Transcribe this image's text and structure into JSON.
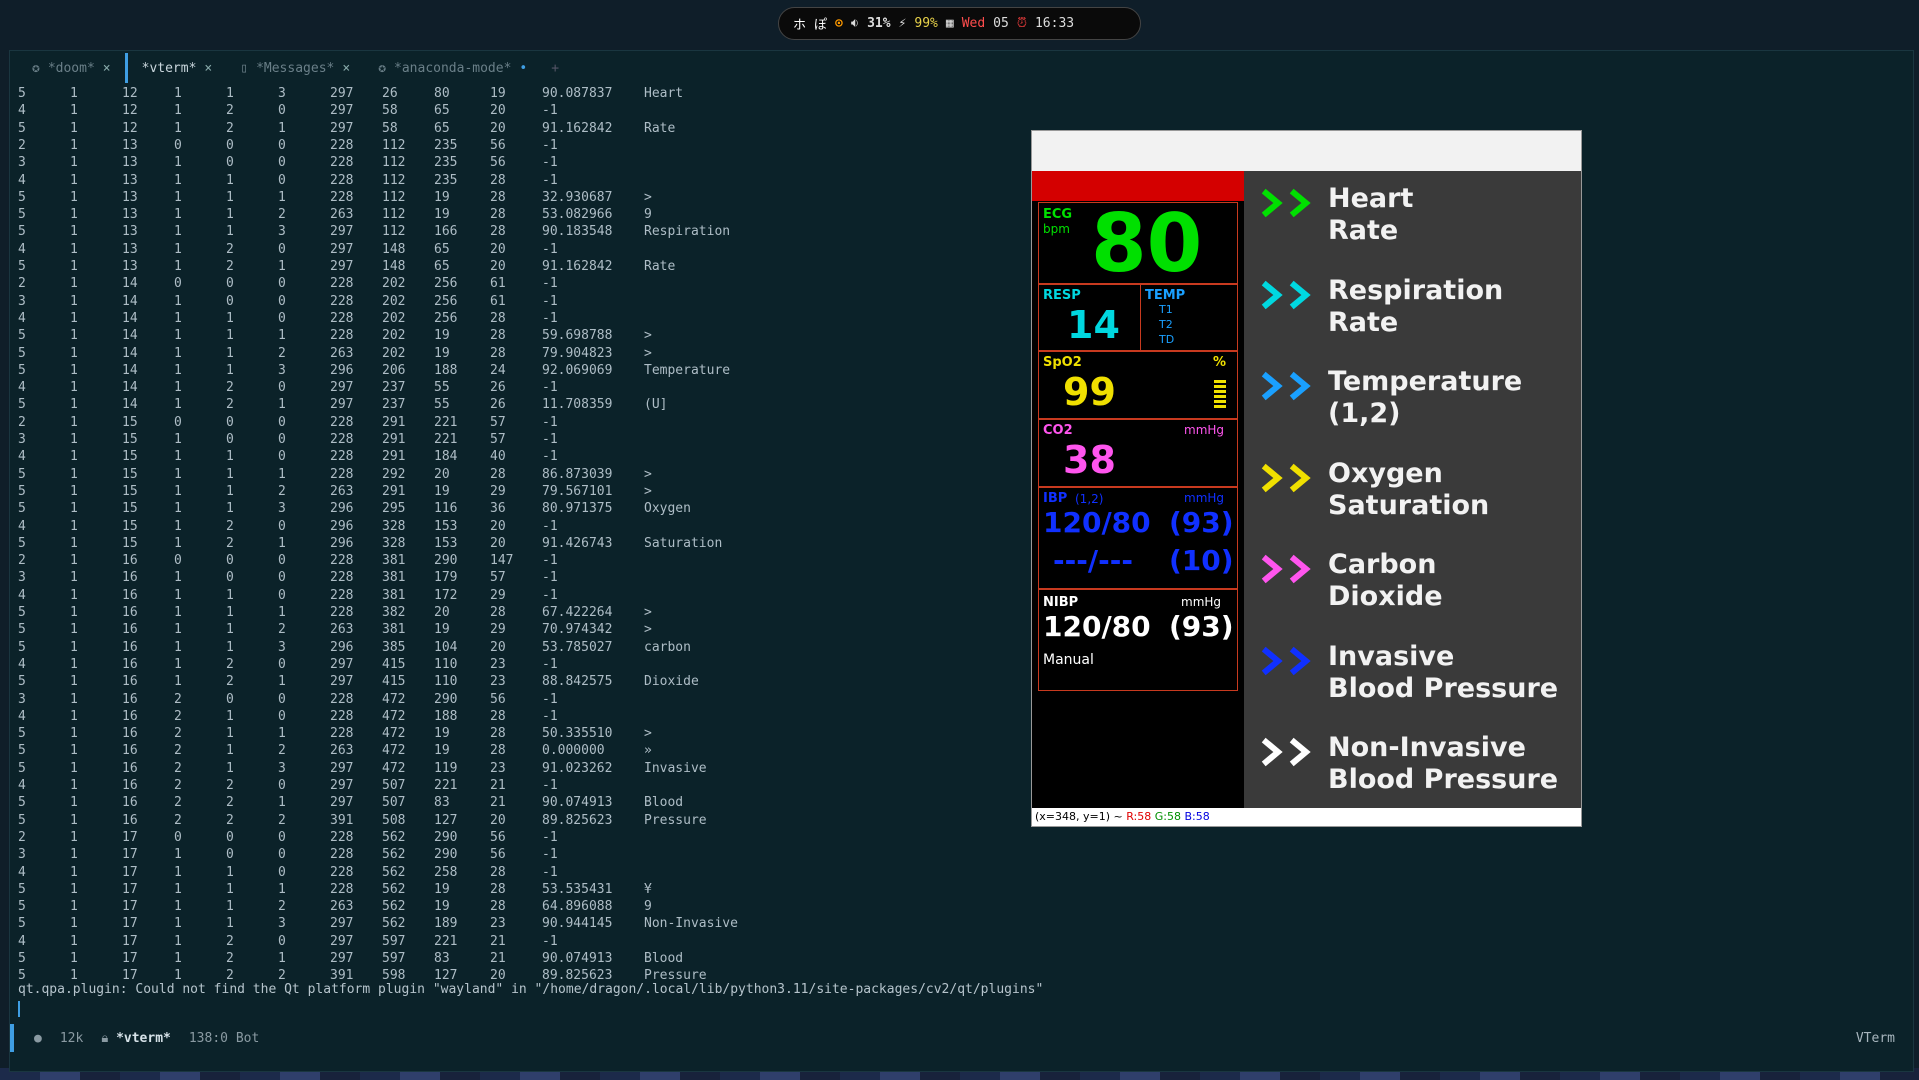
{
  "topbar": {
    "ime1": "ホ",
    "ime2": "ぽ",
    "volume": "31%",
    "battery": "99%",
    "day": "Wed",
    "date": "05",
    "time": "16:33",
    "icons": [
      "rss-icon",
      "speaker-icon",
      "plug-icon",
      "calendar-icon",
      "alarm-icon"
    ]
  },
  "tabs": [
    {
      "label": "*doom*",
      "close": "×"
    },
    {
      "label": "*vterm*",
      "close": "×"
    },
    {
      "label": "*Messages*",
      "close": "×"
    },
    {
      "label": "*anaconda-mode*",
      "close": "•"
    }
  ],
  "tab_add": "+",
  "terminal": {
    "rows": [
      [
        "5",
        "1",
        "12",
        "1",
        "1",
        "3",
        "297",
        "26",
        "80",
        "19",
        "90.087837",
        "Heart"
      ],
      [
        "4",
        "1",
        "12",
        "1",
        "2",
        "0",
        "297",
        "58",
        "65",
        "20",
        "-1",
        ""
      ],
      [
        "5",
        "1",
        "12",
        "1",
        "2",
        "1",
        "297",
        "58",
        "65",
        "20",
        "91.162842",
        "Rate"
      ],
      [
        "2",
        "1",
        "13",
        "0",
        "0",
        "0",
        "228",
        "112",
        "235",
        "56",
        "-1",
        ""
      ],
      [
        "3",
        "1",
        "13",
        "1",
        "0",
        "0",
        "228",
        "112",
        "235",
        "56",
        "-1",
        ""
      ],
      [
        "4",
        "1",
        "13",
        "1",
        "1",
        "0",
        "228",
        "112",
        "235",
        "28",
        "-1",
        ""
      ],
      [
        "5",
        "1",
        "13",
        "1",
        "1",
        "1",
        "228",
        "112",
        "19",
        "28",
        "32.930687",
        ">"
      ],
      [
        "5",
        "1",
        "13",
        "1",
        "1",
        "2",
        "263",
        "112",
        "19",
        "28",
        "53.082966",
        "9"
      ],
      [
        "5",
        "1",
        "13",
        "1",
        "1",
        "3",
        "297",
        "112",
        "166",
        "28",
        "90.183548",
        "Respiration"
      ],
      [
        "4",
        "1",
        "13",
        "1",
        "2",
        "0",
        "297",
        "148",
        "65",
        "20",
        "-1",
        ""
      ],
      [
        "5",
        "1",
        "13",
        "1",
        "2",
        "1",
        "297",
        "148",
        "65",
        "20",
        "91.162842",
        "Rate"
      ],
      [
        "2",
        "1",
        "14",
        "0",
        "0",
        "0",
        "228",
        "202",
        "256",
        "61",
        "-1",
        ""
      ],
      [
        "3",
        "1",
        "14",
        "1",
        "0",
        "0",
        "228",
        "202",
        "256",
        "61",
        "-1",
        ""
      ],
      [
        "4",
        "1",
        "14",
        "1",
        "1",
        "0",
        "228",
        "202",
        "256",
        "28",
        "-1",
        ""
      ],
      [
        "5",
        "1",
        "14",
        "1",
        "1",
        "1",
        "228",
        "202",
        "19",
        "28",
        "59.698788",
        ">"
      ],
      [
        "5",
        "1",
        "14",
        "1",
        "1",
        "2",
        "263",
        "202",
        "19",
        "28",
        "79.904823",
        ">"
      ],
      [
        "5",
        "1",
        "14",
        "1",
        "1",
        "3",
        "296",
        "206",
        "188",
        "24",
        "92.069069",
        "Temperature"
      ],
      [
        "4",
        "1",
        "14",
        "1",
        "2",
        "0",
        "297",
        "237",
        "55",
        "26",
        "-1",
        ""
      ],
      [
        "5",
        "1",
        "14",
        "1",
        "2",
        "1",
        "297",
        "237",
        "55",
        "26",
        "11.708359",
        "(U]"
      ],
      [
        "2",
        "1",
        "15",
        "0",
        "0",
        "0",
        "228",
        "291",
        "221",
        "57",
        "-1",
        ""
      ],
      [
        "3",
        "1",
        "15",
        "1",
        "0",
        "0",
        "228",
        "291",
        "221",
        "57",
        "-1",
        ""
      ],
      [
        "4",
        "1",
        "15",
        "1",
        "1",
        "0",
        "228",
        "291",
        "184",
        "40",
        "-1",
        ""
      ],
      [
        "5",
        "1",
        "15",
        "1",
        "1",
        "1",
        "228",
        "292",
        "20",
        "28",
        "86.873039",
        ">"
      ],
      [
        "5",
        "1",
        "15",
        "1",
        "1",
        "2",
        "263",
        "291",
        "19",
        "29",
        "79.567101",
        ">"
      ],
      [
        "5",
        "1",
        "15",
        "1",
        "1",
        "3",
        "296",
        "295",
        "116",
        "36",
        "80.971375",
        "Oxygen"
      ],
      [
        "4",
        "1",
        "15",
        "1",
        "2",
        "0",
        "296",
        "328",
        "153",
        "20",
        "-1",
        ""
      ],
      [
        "5",
        "1",
        "15",
        "1",
        "2",
        "1",
        "296",
        "328",
        "153",
        "20",
        "91.426743",
        "Saturation"
      ],
      [
        "2",
        "1",
        "16",
        "0",
        "0",
        "0",
        "228",
        "381",
        "290",
        "147",
        "-1",
        ""
      ],
      [
        "3",
        "1",
        "16",
        "1",
        "0",
        "0",
        "228",
        "381",
        "179",
        "57",
        "-1",
        ""
      ],
      [
        "4",
        "1",
        "16",
        "1",
        "1",
        "0",
        "228",
        "381",
        "172",
        "29",
        "-1",
        ""
      ],
      [
        "5",
        "1",
        "16",
        "1",
        "1",
        "1",
        "228",
        "382",
        "20",
        "28",
        "67.422264",
        ">"
      ],
      [
        "5",
        "1",
        "16",
        "1",
        "1",
        "2",
        "263",
        "381",
        "19",
        "29",
        "70.974342",
        ">"
      ],
      [
        "5",
        "1",
        "16",
        "1",
        "1",
        "3",
        "296",
        "385",
        "104",
        "20",
        "53.785027",
        "carbon"
      ],
      [
        "4",
        "1",
        "16",
        "1",
        "2",
        "0",
        "297",
        "415",
        "110",
        "23",
        "-1",
        ""
      ],
      [
        "5",
        "1",
        "16",
        "1",
        "2",
        "1",
        "297",
        "415",
        "110",
        "23",
        "88.842575",
        "Dioxide"
      ],
      [
        "3",
        "1",
        "16",
        "2",
        "0",
        "0",
        "228",
        "472",
        "290",
        "56",
        "-1",
        ""
      ],
      [
        "4",
        "1",
        "16",
        "2",
        "1",
        "0",
        "228",
        "472",
        "188",
        "28",
        "-1",
        ""
      ],
      [
        "5",
        "1",
        "16",
        "2",
        "1",
        "1",
        "228",
        "472",
        "19",
        "28",
        "50.335510",
        ">"
      ],
      [
        "5",
        "1",
        "16",
        "2",
        "1",
        "2",
        "263",
        "472",
        "19",
        "28",
        "0.000000",
        "»"
      ],
      [
        "5",
        "1",
        "16",
        "2",
        "1",
        "3",
        "297",
        "472",
        "119",
        "23",
        "91.023262",
        "Invasive"
      ],
      [
        "4",
        "1",
        "16",
        "2",
        "2",
        "0",
        "297",
        "507",
        "221",
        "21",
        "-1",
        ""
      ],
      [
        "5",
        "1",
        "16",
        "2",
        "2",
        "1",
        "297",
        "507",
        "83",
        "21",
        "90.074913",
        "Blood"
      ],
      [
        "5",
        "1",
        "16",
        "2",
        "2",
        "2",
        "391",
        "508",
        "127",
        "20",
        "89.825623",
        "Pressure"
      ],
      [
        "2",
        "1",
        "17",
        "0",
        "0",
        "0",
        "228",
        "562",
        "290",
        "56",
        "-1",
        ""
      ],
      [
        "3",
        "1",
        "17",
        "1",
        "0",
        "0",
        "228",
        "562",
        "290",
        "56",
        "-1",
        ""
      ],
      [
        "4",
        "1",
        "17",
        "1",
        "1",
        "0",
        "228",
        "562",
        "258",
        "28",
        "-1",
        ""
      ],
      [
        "5",
        "1",
        "17",
        "1",
        "1",
        "1",
        "228",
        "562",
        "19",
        "28",
        "53.535431",
        "¥"
      ],
      [
        "5",
        "1",
        "17",
        "1",
        "1",
        "2",
        "263",
        "562",
        "19",
        "28",
        "64.896088",
        "9"
      ],
      [
        "5",
        "1",
        "17",
        "1",
        "1",
        "3",
        "297",
        "562",
        "189",
        "23",
        "90.944145",
        "Non-Invasive"
      ],
      [
        "4",
        "1",
        "17",
        "1",
        "2",
        "0",
        "297",
        "597",
        "221",
        "21",
        "-1",
        ""
      ],
      [
        "5",
        "1",
        "17",
        "1",
        "2",
        "1",
        "297",
        "597",
        "83",
        "21",
        "90.074913",
        "Blood"
      ],
      [
        "5",
        "1",
        "17",
        "1",
        "2",
        "2",
        "391",
        "598",
        "127",
        "20",
        "89.825623",
        "Pressure"
      ]
    ],
    "error": "qt.qpa.plugin: Could not find the Qt platform plugin \"wayland\" in \"/home/dragon/.local/lib/python3.11/site-packages/cv2/qt/plugins\""
  },
  "modeline": {
    "size": "12k",
    "buffer": "*vterm*",
    "position": "138:0 Bot",
    "mode": "VTerm"
  },
  "monitor": {
    "ecg_label": "ECG",
    "ecg_unit": "bpm",
    "ecg_value": "80",
    "resp_label": "RESP",
    "resp_value": "14",
    "temp_label": "TEMP",
    "temp_t1": "T1",
    "temp_t2": "T2",
    "temp_td": "TD",
    "spo2_label": "SpO2",
    "spo2_unit": "%",
    "spo2_value": "99",
    "co2_label": "CO2",
    "co2_unit": "mmHg",
    "co2_value": "38",
    "ibp_label": "IBP",
    "ibp_channels": "(1,2)",
    "ibp_unit": "mmHg",
    "ibp_value1": "120/80",
    "ibp_mean1": "(93)",
    "ibp_value2": "---/---",
    "ibp_mean2": "(10)",
    "nibp_label": "NIBP",
    "nibp_unit": "mmHg",
    "nibp_value": "120/80",
    "nibp_mean": "(93)",
    "nibp_mode": "Manual",
    "colors": {
      "ecg": "#00e000",
      "resp": "#00d8e0",
      "temp": "#1aa0ff",
      "spo2": "#f0e000",
      "co2": "#ff55ee",
      "ibp": "#1030ff",
      "nibp": "#ffffff",
      "alarm": "#d40000"
    }
  },
  "legend": [
    {
      "line1": "Heart",
      "line2": "Rate",
      "color": "#00e000"
    },
    {
      "line1": "Respiration",
      "line2": "Rate",
      "color": "#00d8e0"
    },
    {
      "line1": "Temperature",
      "line2": "(1,2)",
      "color": "#1aa0ff"
    },
    {
      "line1": "Oxygen",
      "line2": "Saturation",
      "color": "#f0e000"
    },
    {
      "line1": "Carbon",
      "line2": "Dioxide",
      "color": "#ff55ee"
    },
    {
      "line1": "Invasive",
      "line2": "Blood Pressure",
      "color": "#1030ff"
    },
    {
      "line1": "Non-Invasive",
      "line2": "Blood Pressure",
      "color": "#ffffff"
    }
  ],
  "cv_status": {
    "coords": "(x=348, y=1) ~",
    "r": "R:58",
    "g": "G:58",
    "b": "B:58"
  }
}
